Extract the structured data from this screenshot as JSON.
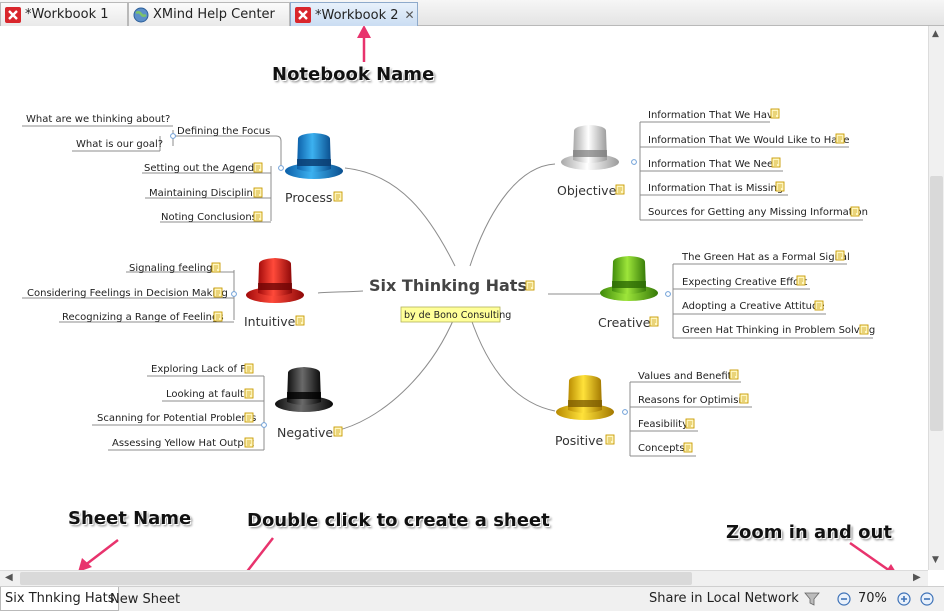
{
  "tabs": [
    {
      "label": "*Workbook 1",
      "icon": "xmind-icon"
    },
    {
      "label": "XMind Help Center",
      "icon": "globe-icon"
    },
    {
      "label": "*Workbook 2",
      "icon": "xmind-icon",
      "active": true
    }
  ],
  "map": {
    "central": "Six Thinking Hats",
    "central_label": "by de Bono Consulting",
    "process": {
      "title": "Process",
      "children": [
        "Defining the Focus",
        "Setting out the Agenda",
        "Maintaining Discipline",
        "Noting Conclusions"
      ],
      "focus_children": [
        "What are we thinking about?",
        "What is our goal?"
      ]
    },
    "intuitive": {
      "title": "Intuitive",
      "children": [
        "Signaling feelings",
        "Considering Feelings in Decision Making",
        "Recognizing a Range of Feelings"
      ]
    },
    "negative": {
      "title": "Negative",
      "children": [
        "Exploring Lack of Fit",
        "Looking at faults",
        "Scanning for Potential Problems",
        "Assessing Yellow Hat Output"
      ]
    },
    "objective": {
      "title": "Objective",
      "children": [
        "Information That We Have",
        "Information That We Would Like to Have",
        "Information That We Need",
        "Information That is Missing",
        "Sources for Getting any Missing Information"
      ]
    },
    "creative": {
      "title": "Creative",
      "children": [
        "The Green Hat as a Formal Signal",
        "Expecting Creative Effort",
        "Adopting a Creative Attitude",
        "Green Hat Thinking in Problem Solving"
      ]
    },
    "positive": {
      "title": "Positive",
      "children": [
        "Values and Benefits",
        "Reasons for Optimism",
        "Feasibility",
        "Concepts"
      ]
    }
  },
  "annotations": {
    "notebook": "Notebook Name",
    "sheet": "Sheet Name",
    "dblclick": "Double click to create a sheet",
    "zoom": "Zoom in and out"
  },
  "sheets": [
    "Six Thnking Hats",
    "New Sheet"
  ],
  "status": {
    "share": "Share in Local Network",
    "zoom": "70%"
  },
  "colors": {
    "accent_arrow": "#e8336d",
    "callout_yellow": "#ffff99",
    "note_icon": "#e6b800"
  }
}
